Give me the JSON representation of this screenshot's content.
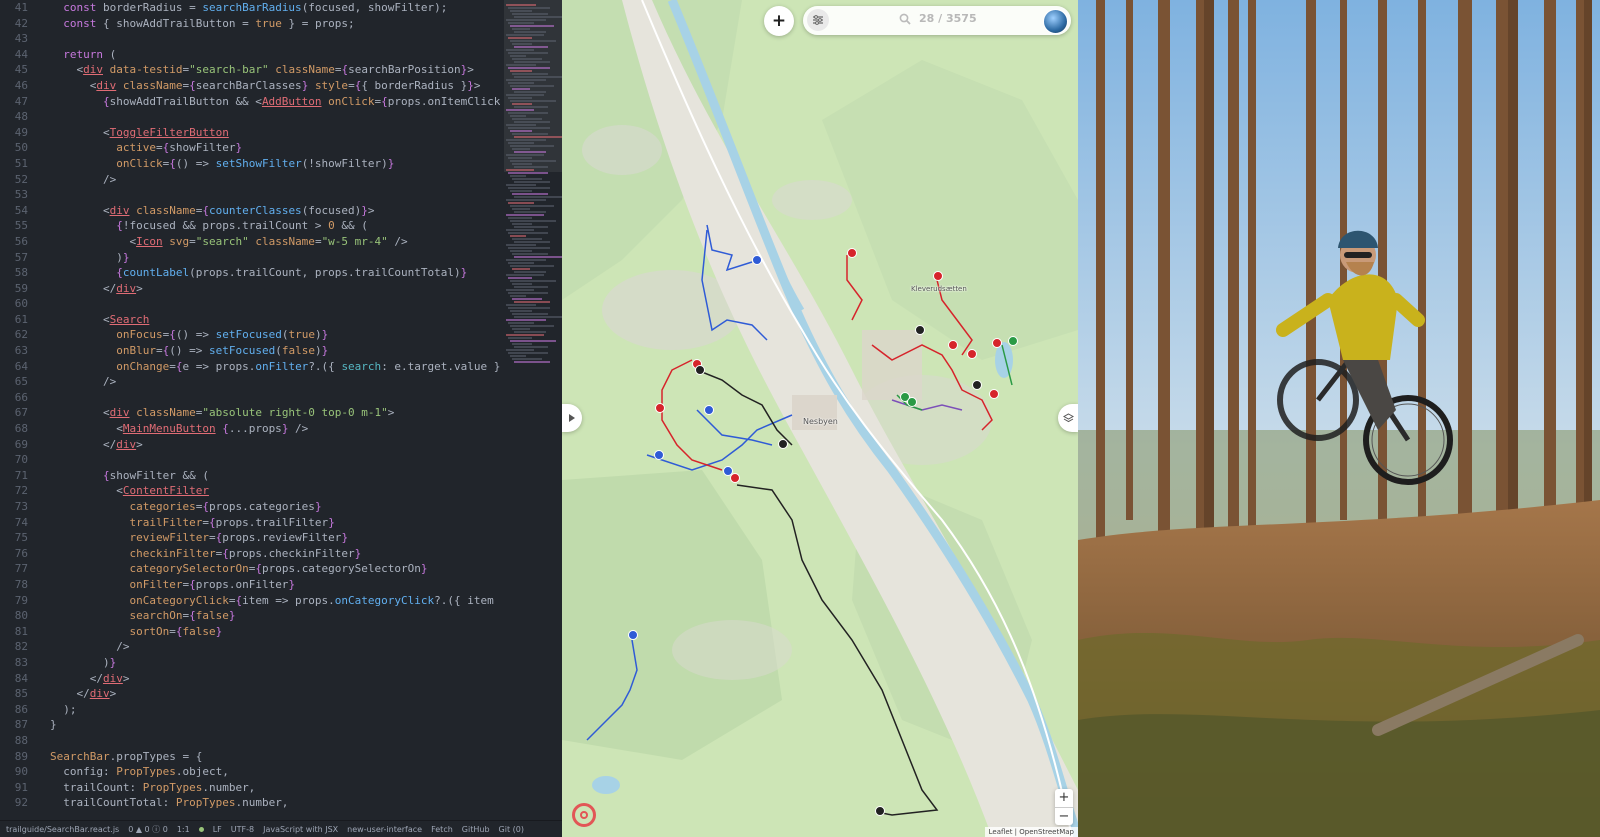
{
  "editor": {
    "lines": [
      {
        "n": "41",
        "html": "  <span class='k'>const</span> borderRadius = <span class='f'>searchBarRadius</span>(focused, showFilter);"
      },
      {
        "n": "42",
        "html": "  <span class='k'>const</span> { showAddTrailButton = <span class='a'>true</span> } = props;"
      },
      {
        "n": "43",
        "html": ""
      },
      {
        "n": "44",
        "html": "  <span class='k'>return</span> ("
      },
      {
        "n": "45",
        "html": "    &lt;<span class='t u'>div</span> <span class='a'>data-testid</span>=<span class='s'>\"search-bar\"</span> <span class='a'>className</span>=<span class='k'>{</span>searchBarPosition<span class='k'>}</span>&gt;"
      },
      {
        "n": "46",
        "html": "      &lt;<span class='t u'>div</span> <span class='a'>className</span>=<span class='k'>{</span>searchBarClasses<span class='k'>}</span> <span class='a'>style</span>=<span class='k'>{</span>{ borderRadius }<span class='k'>}</span>&gt;"
      },
      {
        "n": "47",
        "html": "        <span class='k'>{</span>showAddTrailButton &amp;&amp; &lt;<span class='t u'>AddButton</span> <span class='a'>onClick</span>=<span class='k'>{</span>props.onItemClick<span class='k'>}</span> /"
      },
      {
        "n": "48",
        "html": ""
      },
      {
        "n": "49",
        "html": "        &lt;<span class='t u'>ToggleFilterButton</span>"
      },
      {
        "n": "50",
        "html": "          <span class='a'>active</span>=<span class='k'>{</span>showFilter<span class='k'>}</span>"
      },
      {
        "n": "51",
        "html": "          <span class='a'>onClick</span>=<span class='k'>{</span>() =&gt; <span class='f'>setShowFilter</span>(!showFilter)<span class='k'>}</span>"
      },
      {
        "n": "52",
        "html": "        /&gt;"
      },
      {
        "n": "53",
        "html": ""
      },
      {
        "n": "54",
        "html": "        &lt;<span class='t u'>div</span> <span class='a'>className</span>=<span class='k'>{</span><span class='f'>counterClasses</span>(focused)<span class='k'>}</span>&gt;"
      },
      {
        "n": "55",
        "html": "          <span class='k'>{</span>!focused &amp;&amp; props.trailCount &gt; <span class='a'>0</span> &amp;&amp; ("
      },
      {
        "n": "56",
        "html": "            &lt;<span class='t u'>Icon</span> <span class='a'>svg</span>=<span class='s'>\"search\"</span> <span class='a'>className</span>=<span class='s'>\"w-5 mr-4\"</span> /&gt;"
      },
      {
        "n": "57",
        "html": "          )<span class='k'>}</span>"
      },
      {
        "n": "58",
        "html": "          <span class='k'>{</span><span class='f'>countLabel</span>(props.trailCount, props.trailCountTotal)<span class='k'>}</span>"
      },
      {
        "n": "59",
        "html": "        &lt;/<span class='t u'>div</span>&gt;"
      },
      {
        "n": "60",
        "html": ""
      },
      {
        "n": "61",
        "html": "        &lt;<span class='t u'>Search</span>"
      },
      {
        "n": "62",
        "html": "          <span class='a'>onFocus</span>=<span class='k'>{</span>() =&gt; <span class='f'>setFocused</span>(<span class='a'>true</span>)<span class='k'>}</span>"
      },
      {
        "n": "63",
        "html": "          <span class='a'>onBlur</span>=<span class='k'>{</span>() =&gt; <span class='f'>setFocused</span>(<span class='a'>false</span>)<span class='k'>}</span>"
      },
      {
        "n": "64",
        "html": "          <span class='a'>onChange</span>=<span class='k'>{</span>e =&gt; props.<span class='f'>onFilter</span>?.({ <span class='c'>search</span>: e.target.value })<span class='k'>}</span>"
      },
      {
        "n": "65",
        "html": "        /&gt;"
      },
      {
        "n": "66",
        "html": ""
      },
      {
        "n": "67",
        "html": "        &lt;<span class='t u'>div</span> <span class='a'>className</span>=<span class='s'>\"absolute right-0 top-0 m-1\"</span>&gt;"
      },
      {
        "n": "68",
        "html": "          &lt;<span class='t u'>MainMenuButton</span> <span class='k'>{</span>...props<span class='k'>}</span> /&gt;"
      },
      {
        "n": "69",
        "html": "        &lt;/<span class='t u'>div</span>&gt;"
      },
      {
        "n": "70",
        "html": ""
      },
      {
        "n": "71",
        "html": "        <span class='k'>{</span>showFilter &amp;&amp; ("
      },
      {
        "n": "72",
        "html": "          &lt;<span class='t u'>ContentFilter</span>"
      },
      {
        "n": "73",
        "html": "            <span class='a'>categories</span>=<span class='k'>{</span>props.categories<span class='k'>}</span>"
      },
      {
        "n": "74",
        "html": "            <span class='a'>trailFilter</span>=<span class='k'>{</span>props.trailFilter<span class='k'>}</span>"
      },
      {
        "n": "75",
        "html": "            <span class='a'>reviewFilter</span>=<span class='k'>{</span>props.reviewFilter<span class='k'>}</span>"
      },
      {
        "n": "76",
        "html": "            <span class='a'>checkinFilter</span>=<span class='k'>{</span>props.checkinFilter<span class='k'>}</span>"
      },
      {
        "n": "77",
        "html": "            <span class='a'>categorySelectorOn</span>=<span class='k'>{</span>props.categorySelectorOn<span class='k'>}</span>"
      },
      {
        "n": "78",
        "html": "            <span class='a'>onFilter</span>=<span class='k'>{</span>props.onFilter<span class='k'>}</span>"
      },
      {
        "n": "79",
        "html": "            <span class='a'>onCategoryClick</span>=<span class='k'>{</span>item =&gt; props.<span class='f'>onCategoryClick</span>?.({ item })<span class='k'>}</span>"
      },
      {
        "n": "80",
        "html": "            <span class='a'>searchOn</span>=<span class='k'>{</span><span class='a'>false</span><span class='k'>}</span>"
      },
      {
        "n": "81",
        "html": "            <span class='a'>sortOn</span>=<span class='k'>{</span><span class='a'>false</span><span class='k'>}</span>"
      },
      {
        "n": "82",
        "html": "          /&gt;"
      },
      {
        "n": "83",
        "html": "        )<span class='k'>}</span>"
      },
      {
        "n": "84",
        "html": "      &lt;/<span class='t u'>div</span>&gt;"
      },
      {
        "n": "85",
        "html": "    &lt;/<span class='t u'>div</span>&gt;"
      },
      {
        "n": "86",
        "html": "  );"
      },
      {
        "n": "87",
        "html": "}"
      },
      {
        "n": "88",
        "html": ""
      },
      {
        "n": "89",
        "html": "<span class='a'>SearchBar</span>.propTypes = {"
      },
      {
        "n": "90",
        "html": "  config: <span class='a'>PropTypes</span>.object,"
      },
      {
        "n": "91",
        "html": "  trailCount: <span class='a'>PropTypes</span>.number,"
      },
      {
        "n": "92",
        "html": "  trailCountTotal: <span class='a'>PropTypes</span>.number,"
      }
    ]
  },
  "statusbar": {
    "file": "trailguide/SearchBar.react.js",
    "problems": "0 ▲ 0 ⓘ 0",
    "cursor": "1:1",
    "eol": "LF",
    "encoding": "UTF-8",
    "grammar": "JavaScript with JSX",
    "branch": "new-user-interface",
    "fetch": "Fetch",
    "github": "GitHub",
    "git": "Git (0)"
  },
  "map": {
    "add_label": "+",
    "counter": "28 / 3575",
    "places": {
      "town": "Nesbyen",
      "lake": "Kleverudsætten"
    },
    "zoom_in": "+",
    "zoom_out": "−",
    "attribution": "Leaflet | OpenStreetMap",
    "trail_colors": {
      "red": "#d6242b",
      "blue": "#2f5bd6",
      "black": "#222222",
      "green": "#2a9a45",
      "purple": "#7c4fb8"
    }
  }
}
